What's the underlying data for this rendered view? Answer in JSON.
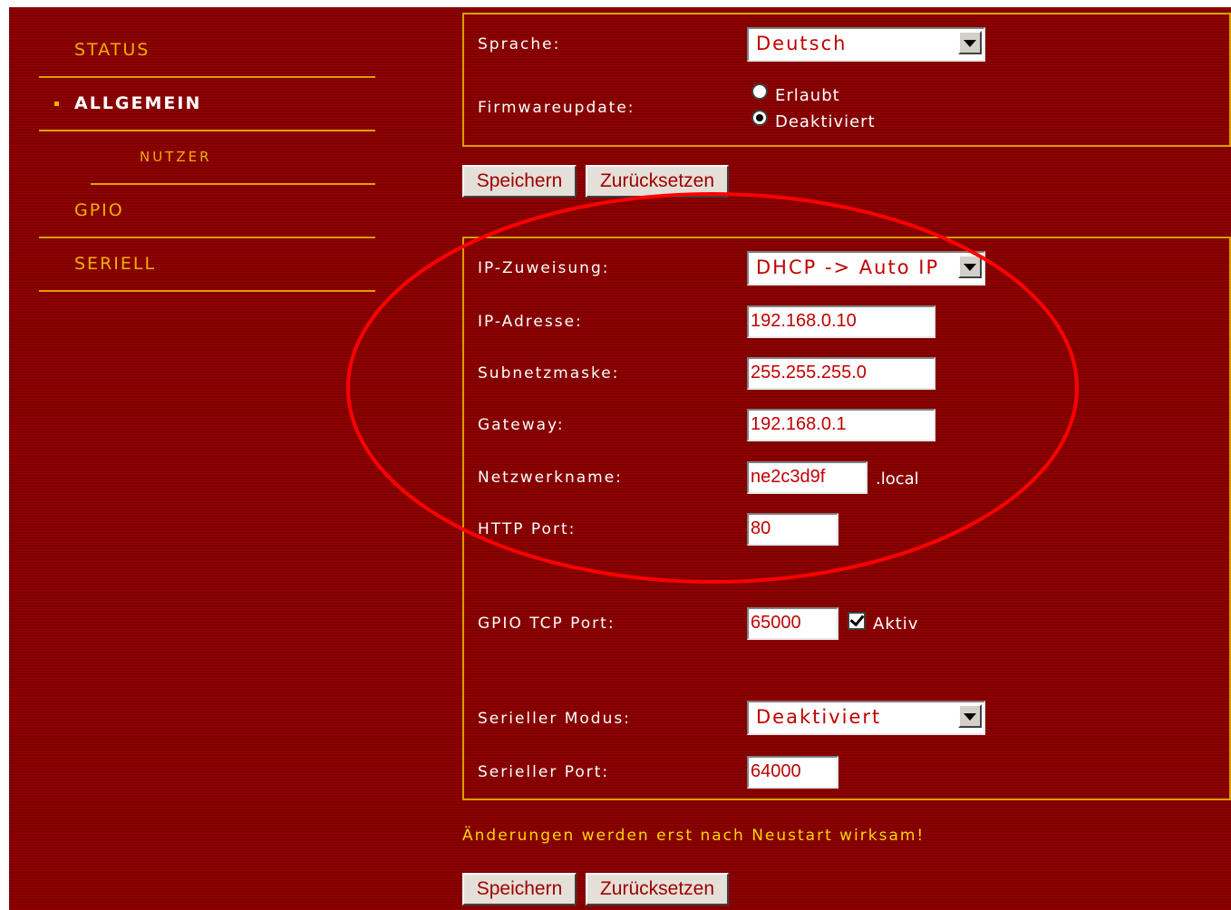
{
  "sidebar": {
    "items": [
      {
        "label": "STATUS"
      },
      {
        "label": "ALLGEMEIN"
      },
      {
        "label": "NUTZER"
      },
      {
        "label": "GPIO"
      },
      {
        "label": "SERIELL"
      }
    ],
    "active": "ALLGEMEIN"
  },
  "general": {
    "language_label": "Sprache:",
    "language_value": "Deutsch",
    "firmware_label": "Firmwareupdate:",
    "firmware_options": [
      "Erlaubt",
      "Deaktiviert"
    ],
    "firmware_selected": "Deaktiviert"
  },
  "buttons": {
    "save": "Speichern",
    "reset": "Zurücksetzen"
  },
  "network": {
    "ip_assignment_label": "IP-Zuweisung:",
    "ip_assignment_value": "DHCP -> Auto IP",
    "ip_address_label": "IP-Adresse:",
    "ip_address_value": "192.168.0.10",
    "subnet_label": "Subnetzmaske:",
    "subnet_value": "255.255.255.0",
    "gateway_label": "Gateway:",
    "gateway_value": "192.168.0.1",
    "network_name_label": "Netzwerkname:",
    "network_name_value": "ne2c3d9f",
    "network_name_suffix": ".local",
    "http_port_label": "HTTP Port:",
    "http_port_value": "80",
    "gpio_port_label": "GPIO TCP Port:",
    "gpio_port_value": "65000",
    "gpio_active_label": "Aktiv",
    "gpio_active_checked": true,
    "serial_mode_label": "Serieller Modus:",
    "serial_mode_value": "Deaktiviert",
    "serial_port_label": "Serieller Port:",
    "serial_port_value": "64000"
  },
  "notice": "Änderungen werden erst nach Neustart wirksam!",
  "colors": {
    "background": "#8a0000",
    "accent": "#f0b000",
    "border": "#d7a000",
    "annotation": "#ff0000"
  }
}
